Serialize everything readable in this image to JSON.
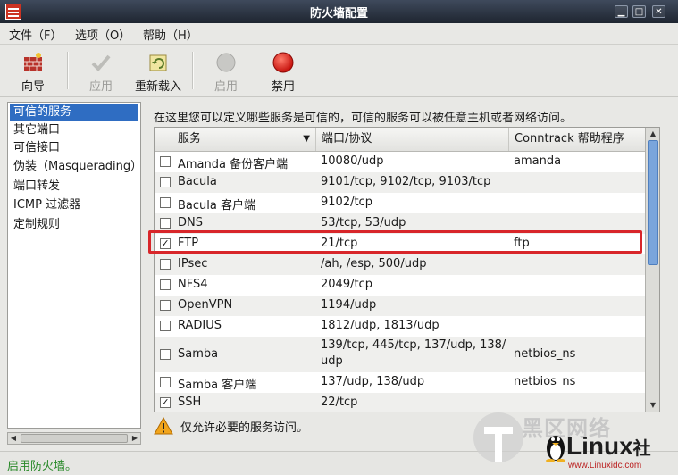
{
  "window": {
    "title": "防火墙配置"
  },
  "menubar": [
    {
      "label": "文件（F）"
    },
    {
      "label": "选项（O）"
    },
    {
      "label": "帮助（H）"
    }
  ],
  "toolbar": {
    "wizard": {
      "label": "向导",
      "icon": "firewall-wizard-icon",
      "enabled": true
    },
    "apply": {
      "label": "应用",
      "icon": "checkmark-icon",
      "enabled": false
    },
    "reload": {
      "label": "重新载入",
      "icon": "reload-icon",
      "enabled": true
    },
    "enable": {
      "label": "启用",
      "icon": "gray-circle-icon",
      "enabled": false
    },
    "disable": {
      "label": "禁用",
      "icon": "red-circle-icon",
      "enabled": true
    }
  },
  "sidebar": {
    "items": [
      {
        "label": "可信的服务",
        "selected": true
      },
      {
        "label": "其它端口",
        "selected": false
      },
      {
        "label": "可信接口",
        "selected": false
      },
      {
        "label": "伪装（Masquerading）",
        "selected": false
      },
      {
        "label": "端口转发",
        "selected": false
      },
      {
        "label": "ICMP 过滤器",
        "selected": false
      },
      {
        "label": "定制规则",
        "selected": false
      }
    ]
  },
  "main": {
    "description": "在这里您可以定义哪些服务是可信的，可信的服务可以被任意主机或者网络访问。",
    "columns": {
      "service": "服务",
      "port": "端口/协议",
      "helper": "Conntrack 帮助程序"
    },
    "rows": [
      {
        "checked": false,
        "service": "Amanda 备份客户端",
        "port": "10080/udp",
        "helper": "amanda"
      },
      {
        "checked": false,
        "service": "Bacula",
        "port": "9101/tcp, 9102/tcp, 9103/tcp",
        "helper": ""
      },
      {
        "checked": false,
        "service": "Bacula 客户端",
        "port": "9102/tcp",
        "helper": ""
      },
      {
        "checked": false,
        "service": "DNS",
        "port": "53/tcp, 53/udp",
        "helper": ""
      },
      {
        "checked": true,
        "service": "FTP",
        "port": "21/tcp",
        "helper": "ftp",
        "highlighted": true
      },
      {
        "checked": false,
        "service": "IPsec",
        "port": "/ah, /esp, 500/udp",
        "helper": ""
      },
      {
        "checked": false,
        "service": "NFS4",
        "port": "2049/tcp",
        "helper": ""
      },
      {
        "checked": false,
        "service": "OpenVPN",
        "port": "1194/udp",
        "helper": ""
      },
      {
        "checked": false,
        "service": "RADIUS",
        "port": "1812/udp, 1813/udp",
        "helper": ""
      },
      {
        "checked": false,
        "service": "Samba",
        "port": "139/tcp, 445/tcp, 137/udp, 138/",
        "port2": "udp",
        "helper": "netbios_ns"
      },
      {
        "checked": false,
        "service": "Samba 客户端",
        "port": "137/udp, 138/udp",
        "helper": "netbios_ns"
      },
      {
        "checked": true,
        "service": "SSH",
        "port": "22/tcp",
        "helper": ""
      }
    ],
    "hint": "仅允许必要的服务访问。"
  },
  "statusbar": {
    "text": "启用防火墙。"
  },
  "watermark": {
    "line1": "黑区网络",
    "line2": "Linux",
    "line2b": "社",
    "url": "www.Linuxidc.com"
  },
  "colors": {
    "selection": "#2f6dc2",
    "highlight_box": "#d8262a",
    "status_text": "#2a8a2a"
  }
}
